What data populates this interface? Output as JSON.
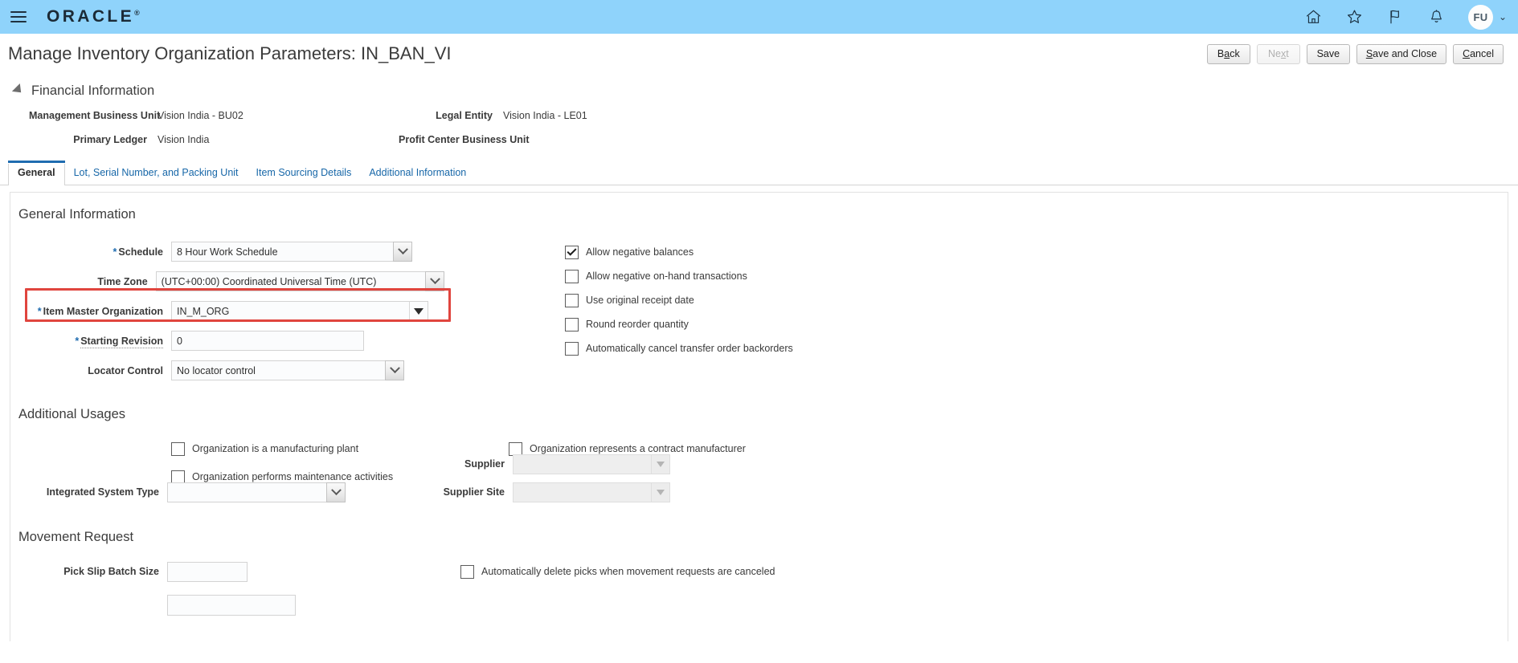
{
  "header": {
    "menu_icon": "hamburger-menu-icon",
    "brand": "ORACLE",
    "brand_tm": "®",
    "icons": [
      {
        "name": "home-icon",
        "label": "Home"
      },
      {
        "name": "favorites-star-icon",
        "label": "Favorites and Recent Items"
      },
      {
        "name": "flag-icon",
        "label": "Watchlist"
      },
      {
        "name": "notifications-bell-icon",
        "label": "Notifications"
      }
    ],
    "avatar_initials": "FU",
    "avatar_chevron": "⌄"
  },
  "page": {
    "title": "Manage Inventory Organization Parameters: IN_BAN_VI"
  },
  "actions": [
    {
      "name": "back-button",
      "label": "Back",
      "accesskey": "a",
      "disabled": false
    },
    {
      "name": "next-button",
      "label": "Next",
      "accesskey": "x",
      "disabled": true
    },
    {
      "name": "save-button",
      "label": "Save",
      "accesskey": "",
      "disabled": false
    },
    {
      "name": "save-and-close-button",
      "label": "Save and Close",
      "accesskey": "S",
      "disabled": false
    },
    {
      "name": "cancel-button",
      "label": "Cancel",
      "accesskey": "C",
      "disabled": false
    }
  ],
  "financial_information": {
    "heading": "Financial Information",
    "expanded": true,
    "fields": [
      {
        "label": "Management Business Unit",
        "value": "Vision India - BU02"
      },
      {
        "label": "Legal Entity",
        "value": "Vision India - LE01"
      },
      {
        "label": "Primary Ledger",
        "value": "Vision India"
      },
      {
        "label": "Profit Center Business Unit",
        "value": ""
      }
    ]
  },
  "tabs": [
    {
      "label": "General",
      "active": true
    },
    {
      "label": "Lot, Serial Number, and Packing Unit",
      "active": false
    },
    {
      "label": "Item Sourcing Details",
      "active": false
    },
    {
      "label": "Additional Information",
      "active": false
    }
  ],
  "general_information": {
    "heading": "General Information",
    "fields": {
      "schedule": {
        "label": "Schedule",
        "value": "8 Hour Work Schedule",
        "required": true,
        "control": "select"
      },
      "time_zone": {
        "label": "Time Zone",
        "value": "(UTC+00:00) Coordinated Universal Time (UTC)",
        "required": false,
        "control": "select"
      },
      "item_master_organization": {
        "label": "Item Master Organization",
        "value": "IN_M_ORG",
        "required": true,
        "control": "lov",
        "highlighted": true
      },
      "starting_revision": {
        "label": "Starting Revision",
        "value": "0",
        "required": true,
        "control": "text"
      },
      "locator_control": {
        "label": "Locator Control",
        "value": "No locator control",
        "required": false,
        "control": "select"
      }
    },
    "checkboxes": [
      {
        "label": "Allow negative balances",
        "checked": true
      },
      {
        "label": "Allow negative on-hand transactions",
        "checked": false
      },
      {
        "label": "Use original receipt date",
        "checked": false
      },
      {
        "label": "Round reorder quantity",
        "checked": false
      },
      {
        "label": "Automatically cancel transfer order backorders",
        "checked": false
      }
    ]
  },
  "additional_usages": {
    "heading": "Additional Usages",
    "checkboxes_left": [
      {
        "label": "Organization is a manufacturing plant",
        "checked": false
      },
      {
        "label": "Organization performs maintenance activities",
        "checked": false
      }
    ],
    "checkboxes_right": [
      {
        "label": "Organization represents a contract manufacturer",
        "checked": false
      }
    ],
    "fields": {
      "integrated_system_type": {
        "label": "Integrated System Type",
        "value": "",
        "control": "select",
        "disabled": false
      },
      "supplier": {
        "label": "Supplier",
        "value": "",
        "control": "lov",
        "disabled": true
      },
      "supplier_site": {
        "label": "Supplier Site",
        "value": "",
        "control": "lov",
        "disabled": true
      }
    }
  },
  "movement_request": {
    "heading": "Movement Request",
    "fields": {
      "pick_slip_batch_size": {
        "label": "Pick Slip Batch Size",
        "value": "",
        "control": "text"
      }
    },
    "checkboxes": [
      {
        "label": "Automatically delete picks when movement requests are canceled",
        "checked": false
      }
    ]
  },
  "colors": {
    "header_bar": "#8fd3fb",
    "accent_link": "#1767a8",
    "tab_active_bar": "#1f6cb0",
    "required_marker": "#1f6cb0",
    "highlight_border": "#e0453e"
  }
}
